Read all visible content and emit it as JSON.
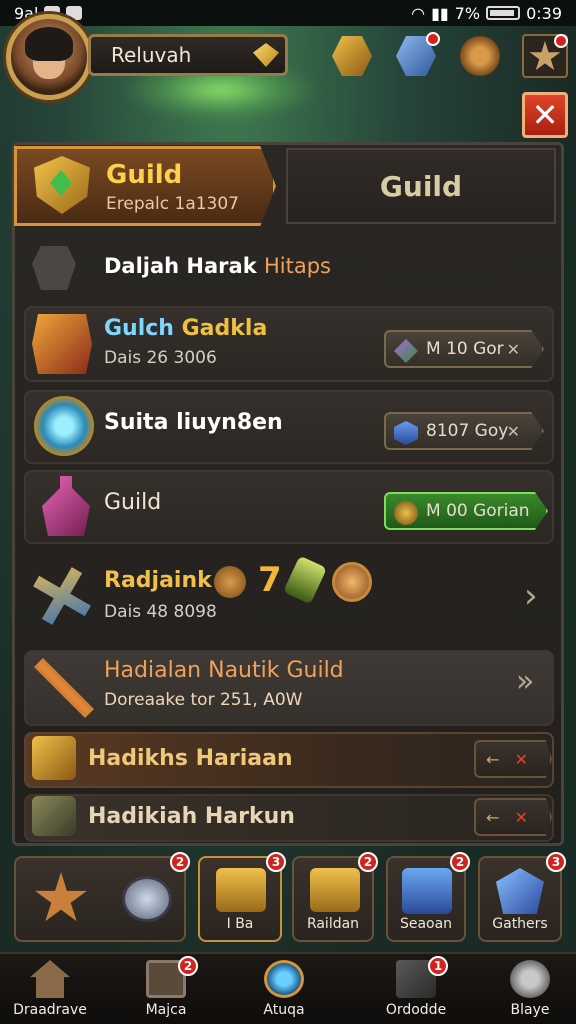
{
  "status_bar": {
    "left": "9al",
    "battery_pct": "7%",
    "time": "0:39"
  },
  "player": {
    "name": "Reluvah"
  },
  "close_label": "✕",
  "tabs": [
    {
      "title": "Guild",
      "subtitle": "Erepalc 1a1307"
    },
    {
      "title": "Guild"
    }
  ],
  "section": {
    "title_main": "Daljah Harak",
    "title_highlight": "Hitaps"
  },
  "rows": [
    {
      "title": "Gulch Gadkla",
      "title_color": "#7fd6ff",
      "title_color2": "#f0c040",
      "subtitle": "Dais 26 3006",
      "pill_text": "M 10 Gor",
      "pill_x": "✕"
    },
    {
      "title": "Suita liuyn8en",
      "subtitle": "",
      "pill_text": "8107 Goy",
      "pill_x": "✕"
    },
    {
      "title": "Guild",
      "subtitle": "",
      "pill_text": "M 00 Gorian"
    },
    {
      "title": "Radjaink",
      "subtitle": "Dais 48 8098",
      "extra_number": "7"
    },
    {
      "title": "Hadialan Nautik Guild",
      "subtitle": "Doreaake tor 251, A0W"
    },
    {
      "title": "Hadikhs Hariaan"
    },
    {
      "title": "Hadikiah Harkun"
    }
  ],
  "row_x": "✕",
  "tray": [
    {
      "label": "",
      "badge": "2"
    },
    {
      "label": "I Ba",
      "badge": "3"
    },
    {
      "label": "Raildan",
      "badge": "2"
    },
    {
      "label": "Seaoan",
      "badge": "2"
    },
    {
      "label": "Gathers",
      "badge": "3"
    }
  ],
  "hud_badges": {
    "gem": "1"
  },
  "nav": [
    {
      "label": "Draadrave",
      "badge": ""
    },
    {
      "label": "Majca",
      "badge": "2"
    },
    {
      "label": "Atuqa",
      "badge": ""
    },
    {
      "label": "Ordodde",
      "badge": "1"
    },
    {
      "label": "Blaye",
      "badge": ""
    }
  ],
  "colors": {
    "accent_gold": "#ffd04a",
    "green_pill": "#2f7a2a",
    "close_red": "#d3331f"
  }
}
